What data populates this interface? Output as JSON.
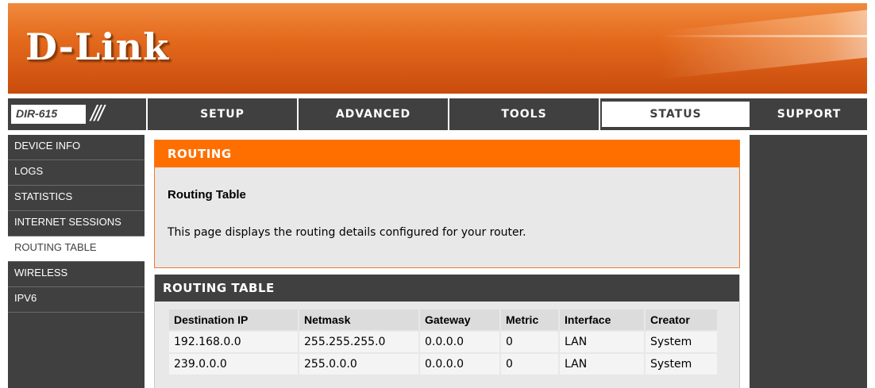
{
  "brand": {
    "logo_text": "D-Link",
    "model": "DIR-615",
    "accent": "#ff6f00",
    "nav_bg": "#404040"
  },
  "nav": {
    "setup": "SETUP",
    "advanced": "ADVANCED",
    "tools": "TOOLS",
    "status": "STATUS",
    "support": "SUPPORT"
  },
  "sidebar": {
    "items": [
      {
        "label": "DEVICE INFO"
      },
      {
        "label": "LOGS"
      },
      {
        "label": "STATISTICS"
      },
      {
        "label": "INTERNET SESSIONS"
      },
      {
        "label": "ROUTING TABLE"
      },
      {
        "label": "WIRELESS"
      },
      {
        "label": "IPV6"
      }
    ],
    "active_index": 4
  },
  "intro": {
    "header": "ROUTING",
    "title": "Routing Table",
    "text": "This page displays the routing details configured for your router."
  },
  "routing_table": {
    "header": "ROUTING TABLE",
    "columns": [
      "Destination IP",
      "Netmask",
      "Gateway",
      "Metric",
      "Interface",
      "Creator"
    ],
    "rows": [
      [
        "192.168.0.0",
        "255.255.255.0",
        "0.0.0.0",
        "0",
        "LAN",
        "System"
      ],
      [
        "239.0.0.0",
        "255.0.0.0",
        "0.0.0.0",
        "0",
        "LAN",
        "System"
      ]
    ]
  }
}
